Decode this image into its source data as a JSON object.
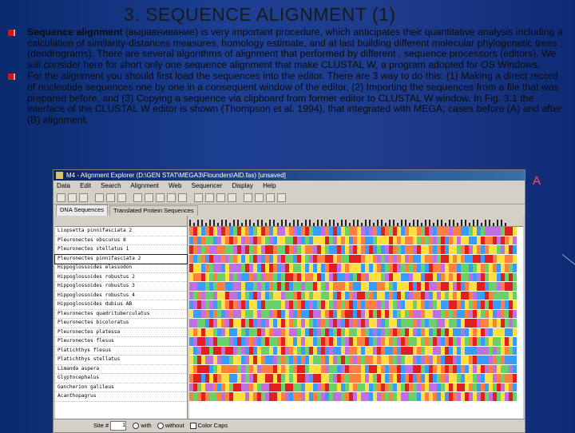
{
  "slide": {
    "title": "3. SEQUENCE ALIGNMENT (1)",
    "bullet1_bold": "Sequence alignment",
    "bullet1_rest": " (выравнивание) is very important procedure, which anticipates their quantitative analysis including a calculation of similarity-distances measures, homology estimate, and at last building different molecular phylogenetic trees (dendrograms). There are several algorithms of alignment that performed by different , sequence processors (editors). We will consider here for short only one sequence alignment that make CLUSTAL W, a program adopted for OS Windows.",
    "bullet2": "For the alignment you should first load the sequences into the editor. There are 3 way to do this: (1) Making a direct record of nucleotide sequences one by one in a consequent window of the editor, (2) Importing the sequences from a file that was prepared before, and (3) Copying a sequence via clipboard from former editor to CLUSTAL W window. In Fig. 3.1 the interface of the CLUSTAL W editor is shown (Thompson et al. 1994), that integrated with MEGA; cases before (A) and after (B) alignment.",
    "label_a": "A"
  },
  "app": {
    "window_title": "M4 - Alignment Explorer (D:\\GEN STAT\\MEGA3\\Flounders\\AlD.fas) [unsaved]",
    "menu": [
      "Data",
      "Edit",
      "Search",
      "Alignment",
      "Web",
      "Sequencer",
      "Display",
      "Help"
    ],
    "tabs": [
      "DNA Sequences",
      "Translated Protein Sequences"
    ],
    "sequence_names": [
      "Liopsetta pinnifasciata 2",
      "Pleuronectes obscurus 8",
      "Pleuronectes stellatus 1",
      "Pleuronectes pinnifasciata 2",
      "Hippoglossoides elassodon",
      "Hippoglossoides robustus 2",
      "Hippoglossoides robustus 3",
      "Hippoglossoides robustus 4",
      "Hippoglossoides dubius AB",
      "Pleuronectes quadrituberculatus",
      "Pleuronectes bicoloratus",
      "Pleuronectes platessa",
      "Pleuronectes flesus",
      "Platichthys flesus",
      "Platichthys stellatus",
      "Limanda aspera",
      "Glyptocephalus",
      "Gancherion galileus",
      "Acanthopagrus"
    ],
    "status": {
      "site_label": "Site #",
      "site_value": "1",
      "with_gaps": "with",
      "without_gaps": "without",
      "caps_label": "Color Caps"
    }
  },
  "colors": {
    "A": "#ffe040",
    "C": "#3a9bff",
    "G": "#ff8040",
    "T": "#e02020"
  }
}
